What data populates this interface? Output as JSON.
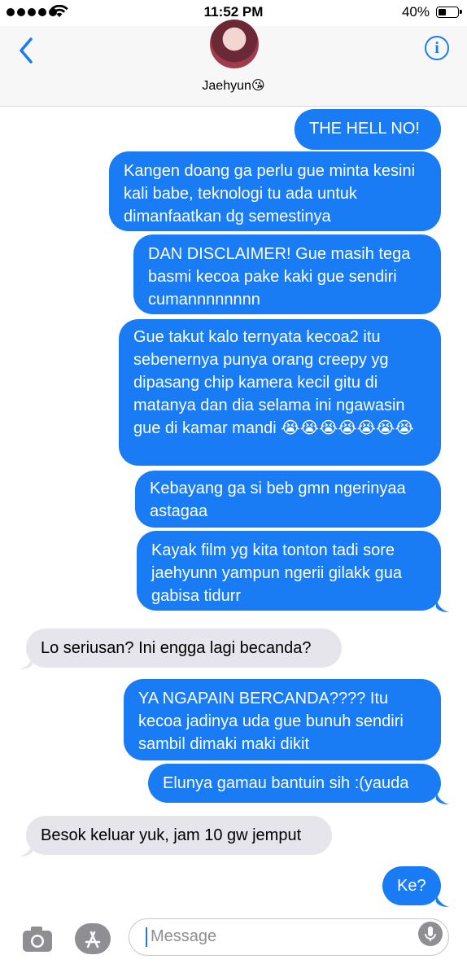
{
  "status_bar": {
    "time": "11:52 PM",
    "battery": "40%",
    "battery_level": 0.4,
    "signal_dots": 5
  },
  "header": {
    "contact_name": "Jaehyun😘",
    "back_icon": "chevron-left-icon",
    "info_icon": "info-icon",
    "info_glyph": "i"
  },
  "messages": [
    {
      "dir": "out",
      "text": "THE HELL NO!"
    },
    {
      "dir": "out",
      "text": "Kangen doang ga perlu gue minta kesini kali babe, teknologi tu ada untuk dimanfaatkan dg semestinya"
    },
    {
      "dir": "out",
      "text": "DAN DISCLAIMER! Gue masih tega basmi kecoa pake kaki gue sendiri cumannnnnnnn"
    },
    {
      "dir": "out",
      "text": "Gue takut kalo ternyata kecoa2 itu sebenernya punya orang creepy yg dipasang chip kamera kecil gitu di matanya dan dia selama ini ngawasin gue di kamar mandi 😭😭😭😭😭😭😭"
    },
    {
      "dir": "out",
      "text": "Kebayang ga si beb gmn ngerinyaa astagaa"
    },
    {
      "dir": "out",
      "text": "Kayak film yg kita tonton tadi sore jaehyunn yampun ngerii gilakk gua gabisa tidurr"
    },
    {
      "dir": "in",
      "text": "Lo seriusan? Ini engga lagi becanda?"
    },
    {
      "dir": "out",
      "text": "YA NGAPAIN BERCANDA???? Itu kecoa jadinya uda gue bunuh sendiri sambil dimaki maki dikit"
    },
    {
      "dir": "out",
      "text": "Elunya gamau bantuin sih :(yauda"
    },
    {
      "dir": "in",
      "text": "Besok keluar yuk, jam 10 gw jemput"
    },
    {
      "dir": "out",
      "text": "Ke?"
    }
  ],
  "input_bar": {
    "placeholder": "Message",
    "camera_icon": "camera-icon",
    "apps_icon": "app-store-icon",
    "mic_icon": "microphone-icon"
  },
  "colors": {
    "outgoing_bubble": "#1a7cf5",
    "incoming_bubble": "#e6e5eb",
    "accent": "#1a7cf5"
  }
}
